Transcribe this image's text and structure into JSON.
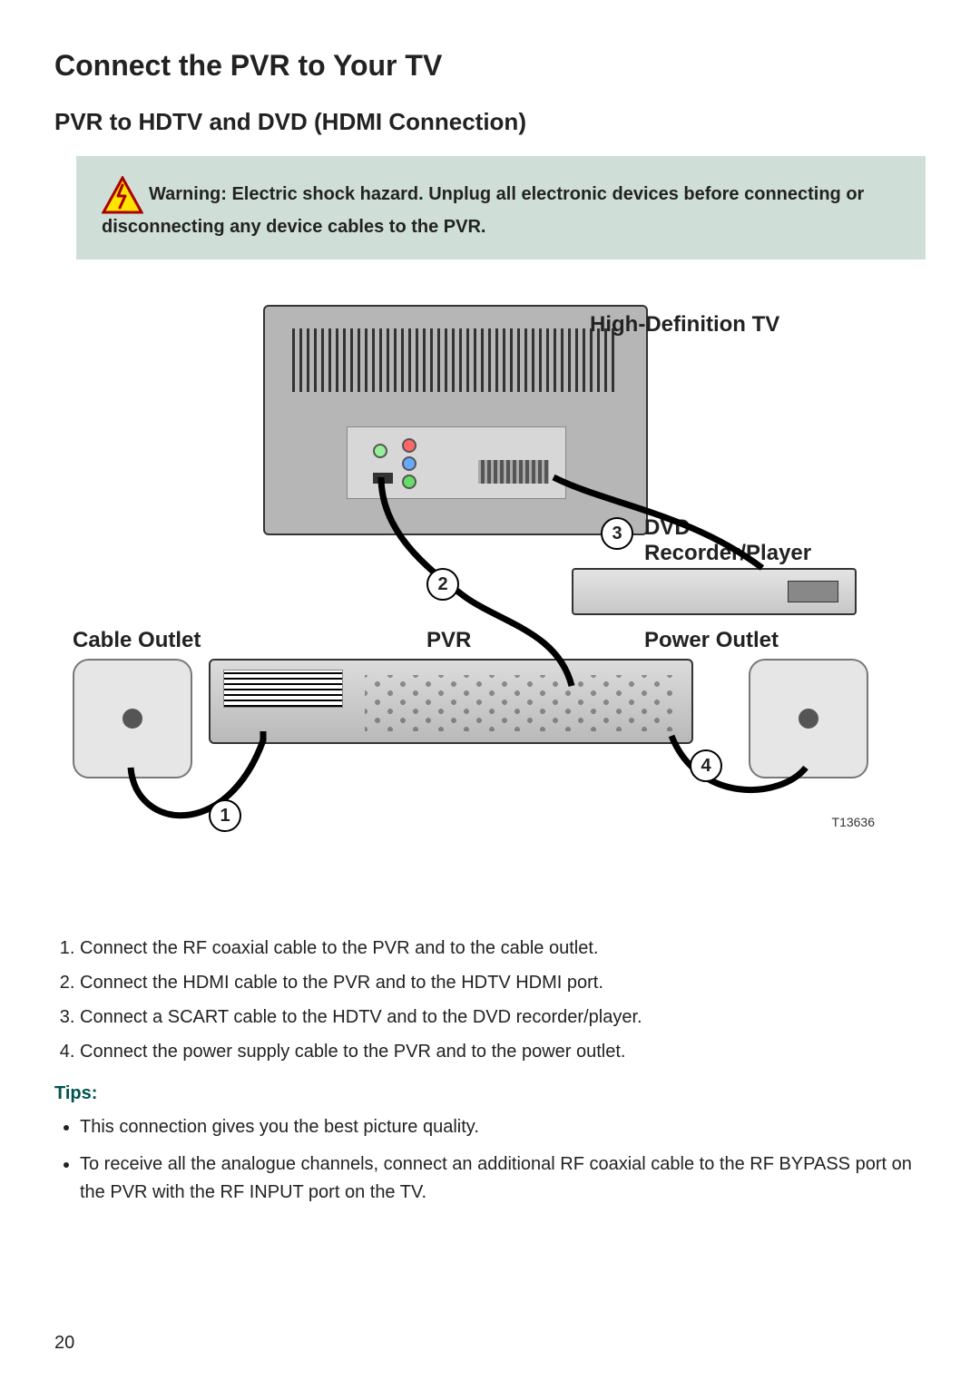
{
  "title": "Connect the PVR to Your TV",
  "subtitle": "PVR to HDTV and DVD (HDMI Connection)",
  "warning": "Warning: Electric shock hazard. Unplug all electronic devices before connecting or disconnecting any device cables to the PVR.",
  "diagram": {
    "labels": {
      "hdtv": "High-Definition TV",
      "dvd_line1": "DVD",
      "dvd_line2": "Recorder/Player",
      "cable_outlet": "Cable Outlet",
      "pvr": "PVR",
      "power_outlet": "Power Outlet"
    },
    "numbers": {
      "1": "1",
      "2": "2",
      "3": "3",
      "4": "4"
    },
    "figure_id": "T13636"
  },
  "steps": [
    "Connect the RF coaxial cable to the PVR and to the cable outlet.",
    "Connect the HDMI cable to the PVR and to the HDTV HDMI port.",
    "Connect a SCART cable to the HDTV and to the DVD recorder/player.",
    "Connect the power supply cable to the PVR and to the power outlet."
  ],
  "tips_heading": "Tips:",
  "tips": [
    "This connection gives you the best picture quality.",
    "To receive all the analogue channels, connect an additional RF coaxial cable to the RF BYPASS port on the PVR with the RF INPUT port on the TV."
  ],
  "page_number": "20"
}
